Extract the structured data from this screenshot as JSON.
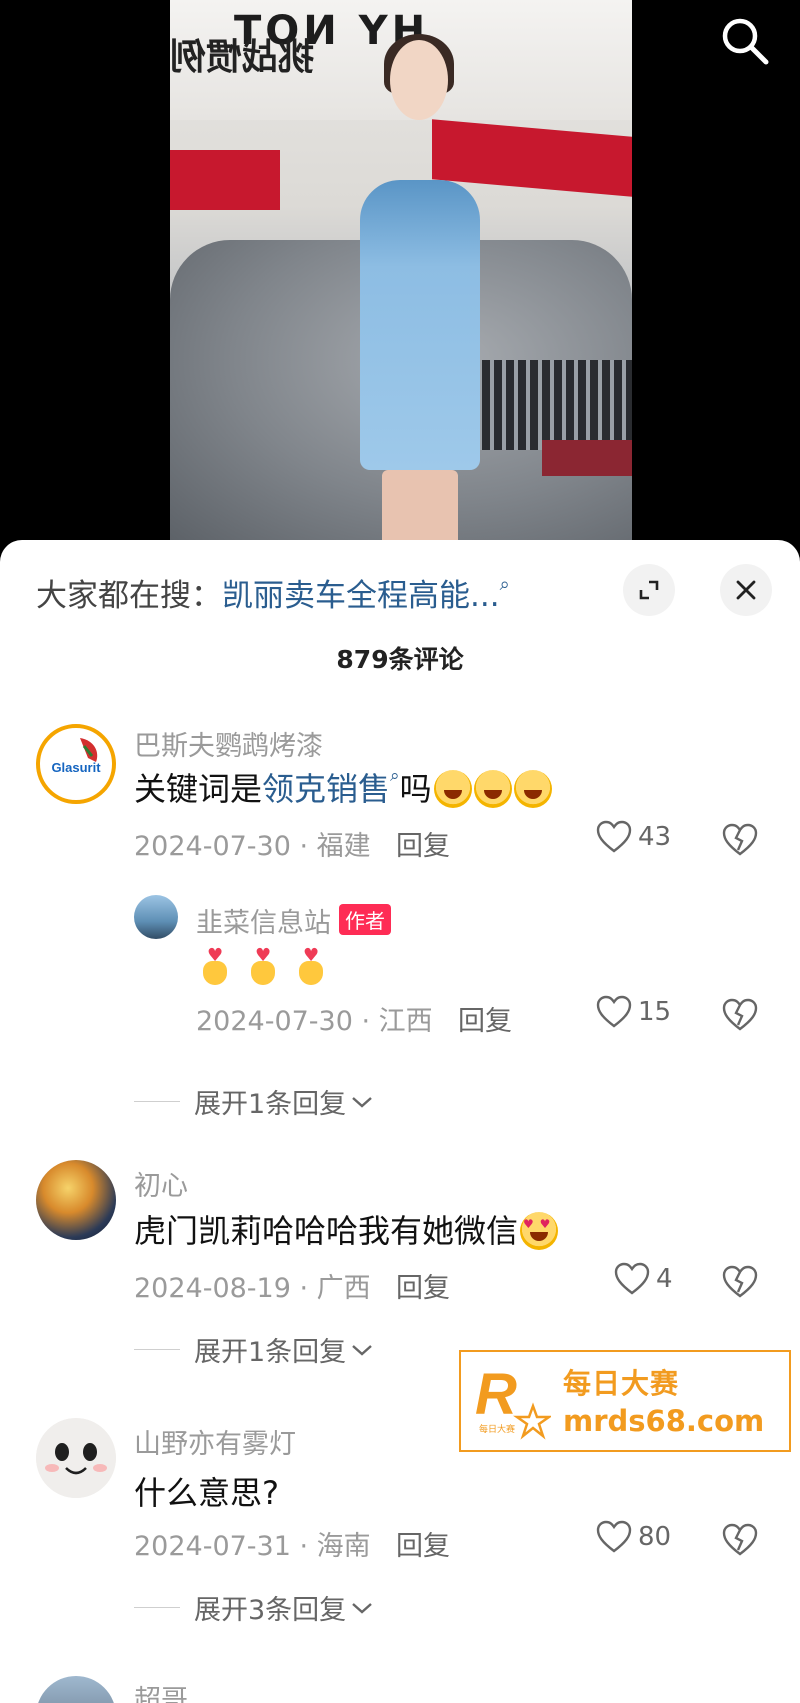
{
  "hot_search": {
    "prefix": "大家都在搜：",
    "keyword": "凯丽卖车全程高能...",
    "search_glyph": "⌕"
  },
  "comment_count": "879条评论",
  "comments": [
    {
      "user": "巴斯夫鹦鹉烤漆",
      "text_before": "关键词是",
      "keyword": "领克销售",
      "text_after": "吗",
      "date_region": "2024-07-30 · 福建",
      "reply_label": "回复",
      "likes": "43",
      "avatar_text": "Glasurit"
    },
    {
      "user": "韭菜信息站",
      "badge": "作者",
      "date_region": "2024-07-30 · 江西",
      "reply_label": "回复",
      "likes": "15"
    },
    {
      "expand_label": "展开1条回复"
    },
    {
      "user": "初心",
      "text": "虎门凯莉哈哈哈我有她微信",
      "date_region": "2024-08-19 · 广西",
      "reply_label": "回复",
      "likes": "4",
      "expand_label": "展开1条回复"
    },
    {
      "user": "山野亦有雾灯",
      "text": "什么意思?",
      "date_region": "2024-07-31 · 海南",
      "reply_label": "回复",
      "likes": "80",
      "expand_label": "展开3条回复"
    },
    {
      "user": "超哥"
    }
  ],
  "watermark": {
    "title": "每日大赛",
    "url": "mrds68.com",
    "logo_letter": "R",
    "logo_small": "每日大赛"
  },
  "video": {
    "sign_text": "HY NOT",
    "sign_text2": "挑战惯例"
  },
  "colors": {
    "link": "#2a5d8f",
    "author_badge": "#fe2c55",
    "watermark": "#f29b1f"
  },
  "icons": [
    "search-icon",
    "expand-icon",
    "close-icon",
    "heart-icon",
    "dislike-icon",
    "chevron-down-icon"
  ]
}
